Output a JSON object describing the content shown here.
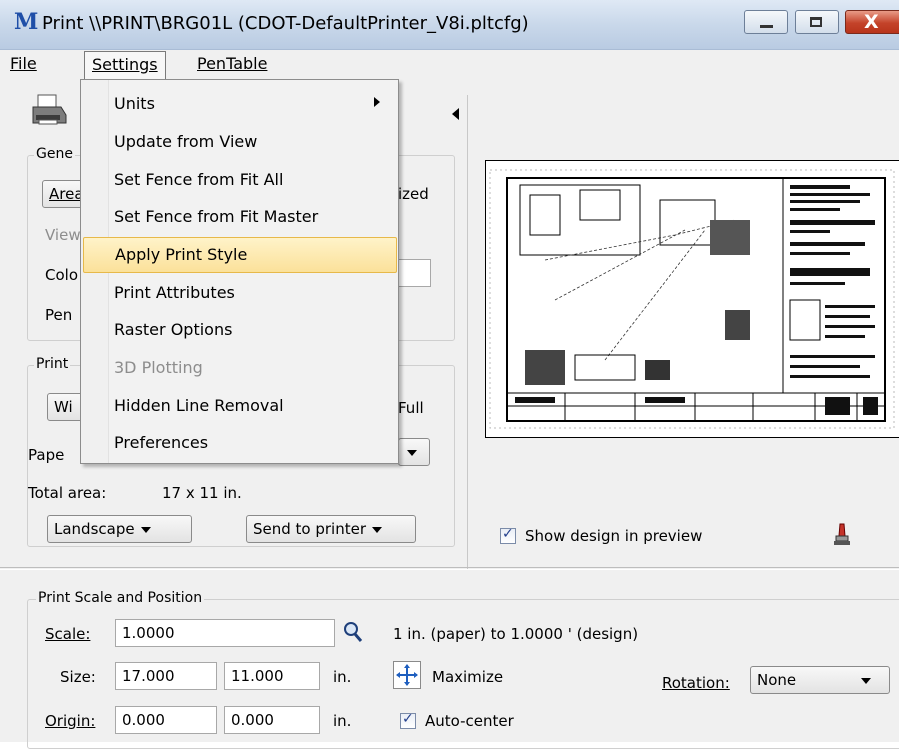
{
  "window": {
    "title": "Print \\\\PRINT\\BRG01L  (CDOT-DefaultPrinter_V8i.pltcfg)",
    "app_icon": "microstation-m-icon",
    "close_glyph": "X"
  },
  "menubar": {
    "file": "File",
    "settings": "Settings",
    "pentable": "PenTable"
  },
  "settings_menu": {
    "items": [
      {
        "label": "Units",
        "has_submenu": true,
        "state": "normal"
      },
      {
        "label": "Update from View",
        "state": "normal"
      },
      {
        "label": "Set Fence from Fit All",
        "state": "normal"
      },
      {
        "label": "Set Fence from Fit Master",
        "state": "normal"
      },
      {
        "label": "Apply Print Style",
        "state": "highlighted"
      },
      {
        "label": "Print Attributes",
        "state": "normal"
      },
      {
        "label": "Raster Options",
        "state": "normal"
      },
      {
        "label": "3D Plotting",
        "state": "disabled"
      },
      {
        "label": "Hidden Line Removal",
        "state": "normal"
      },
      {
        "label": "Preferences",
        "state": "normal"
      }
    ]
  },
  "general": {
    "group_label": "Gene",
    "area_label": "Area",
    "area_suffix": "ized",
    "view_label": "View",
    "color_label": "Colo",
    "pen_label": "Pen"
  },
  "printer": {
    "group_label": "Print",
    "windows_btn": "Wi",
    "full_label": "Full",
    "paper_label": "Pape",
    "total_area_label": "Total area:",
    "total_area_value": "17 x 11 in.",
    "orientation": "Landscape",
    "destination": "Send to printer"
  },
  "preview": {
    "show_design_label": "Show design in preview",
    "show_design_checked": true
  },
  "scale_position": {
    "group_label": "Print Scale and Position",
    "scale_label": "Scale:",
    "scale_value": "1.0000",
    "scale_description": "1 in. (paper) to 1.0000 ' (design)",
    "size_label": "Size:",
    "size_w": "17.000",
    "size_h": "11.000",
    "size_unit": "in.",
    "maximize_label": "Maximize",
    "rotation_label": "Rotation:",
    "rotation_value": "None",
    "origin_label": "Origin:",
    "origin_x": "0.000",
    "origin_y": "0.000",
    "origin_unit": "in.",
    "autocenter_label": "Auto-center",
    "autocenter_checked": true
  }
}
